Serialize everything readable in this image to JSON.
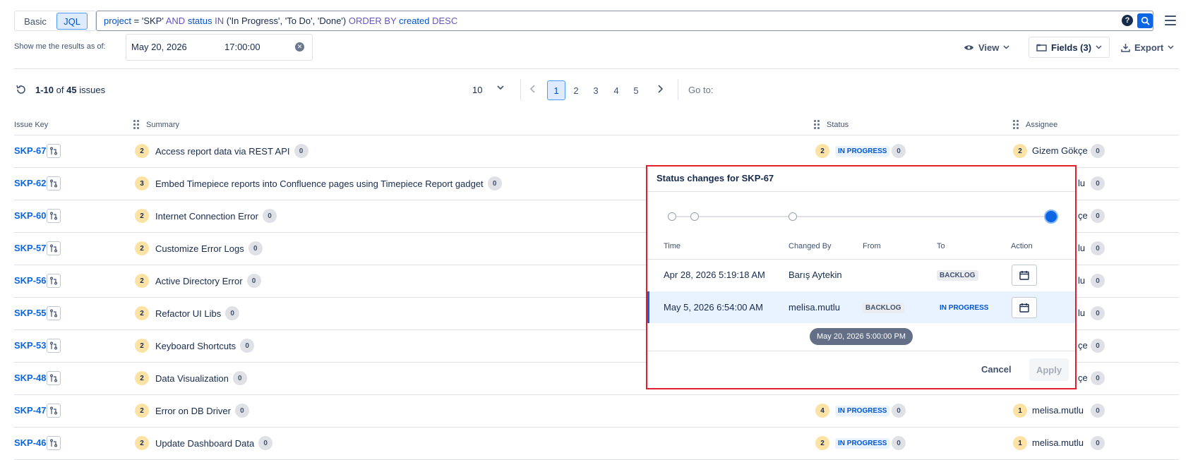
{
  "search": {
    "mode_basic": "Basic",
    "mode_jql": "JQL",
    "query_parts": [
      {
        "text": "project",
        "kind": "field"
      },
      {
        "text": " = ",
        "kind": "op"
      },
      {
        "text": "'SKP'",
        "kind": "val"
      },
      {
        "text": " AND ",
        "kind": "kw"
      },
      {
        "text": "status",
        "kind": "field"
      },
      {
        "text": " IN ",
        "kind": "kw"
      },
      {
        "text": "('In Progress', 'To Do', 'Done')",
        "kind": "val"
      },
      {
        "text": " ORDER BY ",
        "kind": "kw"
      },
      {
        "text": "created",
        "kind": "field"
      },
      {
        "text": " DESC",
        "kind": "kw"
      }
    ],
    "help_label": "?"
  },
  "asof": {
    "label": "Show me the results as of:",
    "date": "May 20, 2026",
    "time": "17:00:00"
  },
  "toolbar": {
    "view": "View",
    "fields": "Fields (3)",
    "export": "Export"
  },
  "paging": {
    "range": "1-10",
    "of": "of",
    "total": "45",
    "unit": "issues",
    "page_size": "10",
    "pages": [
      "1",
      "2",
      "3",
      "4",
      "5"
    ],
    "current_page": "1",
    "goto": "Go to:"
  },
  "columns": {
    "key": "Issue Key",
    "summary": "Summary",
    "status": "Status",
    "assignee": "Assignee"
  },
  "rows": [
    {
      "key": "SKP-67",
      "count": "2",
      "summary": "Access report data via REST API",
      "zero": "0",
      "status_count": "2",
      "status": "IN PROGRESS",
      "status_zero": "0",
      "assignee_count": "2",
      "assignee": "Gizem Gökçe",
      "assignee_zero": "0"
    },
    {
      "key": "SKP-62",
      "count": "3",
      "summary": "Embed Timepiece reports into Confluence pages using Timepiece Report gadget",
      "zero": "0",
      "assignee_tail": "lu",
      "assignee_zero": "0"
    },
    {
      "key": "SKP-60",
      "count": "2",
      "summary": "Internet Connection Error",
      "zero": "0",
      "assignee_tail": "çe",
      "assignee_zero": "0"
    },
    {
      "key": "SKP-57",
      "count": "2",
      "summary": "Customize Error Logs",
      "zero": "0",
      "assignee_tail": "lu",
      "assignee_zero": "0"
    },
    {
      "key": "SKP-56",
      "count": "2",
      "summary": "Active Directory Error",
      "zero": "0",
      "assignee_tail": "lu",
      "assignee_zero": "0"
    },
    {
      "key": "SKP-55",
      "count": "2",
      "summary": "Refactor UI Libs",
      "zero": "0",
      "assignee_tail": "lu",
      "assignee_zero": "0"
    },
    {
      "key": "SKP-53",
      "count": "2",
      "summary": "Keyboard Shortcuts",
      "zero": "0",
      "assignee_tail": "çe",
      "assignee_zero": "0"
    },
    {
      "key": "SKP-48",
      "count": "2",
      "summary": "Data Visualization",
      "zero": "0",
      "assignee_tail": "çe",
      "assignee_zero": "0"
    },
    {
      "key": "SKP-47",
      "count": "2",
      "summary": "Error on DB Driver",
      "zero": "0",
      "status_count": "4",
      "status": "IN PROGRESS",
      "status_zero": "0",
      "assignee_count": "1",
      "assignee": "melisa.mutlu",
      "assignee_zero": "0"
    },
    {
      "key": "SKP-46",
      "count": "2",
      "summary": "Update Dashboard Data",
      "zero": "0",
      "status_count": "2",
      "status": "IN PROGRESS",
      "status_zero": "0",
      "assignee_count": "1",
      "assignee": "melisa.mutlu",
      "assignee_zero": "0"
    }
  ],
  "popup": {
    "title": "Status changes for SKP-67",
    "headers": {
      "time": "Time",
      "changed_by": "Changed By",
      "from": "From",
      "to": "To",
      "action": "Action"
    },
    "changes": [
      {
        "time": "Apr 28, 2026 5:19:18 AM",
        "changed_by": "Barış Aytekin",
        "from": "",
        "to": "BACKLOG"
      },
      {
        "time": "May 5, 2026 6:54:00 AM",
        "changed_by": "melisa.mutlu",
        "from": "BACKLOG",
        "to": "IN PROGRESS"
      }
    ],
    "tooltip": "May 20, 2026 5:00:00 PM",
    "cancel": "Cancel",
    "apply": "Apply"
  },
  "colors": {
    "accent": "#0c66e4",
    "popup_border": "#e2202d",
    "count_badge": "#fce3a5"
  }
}
